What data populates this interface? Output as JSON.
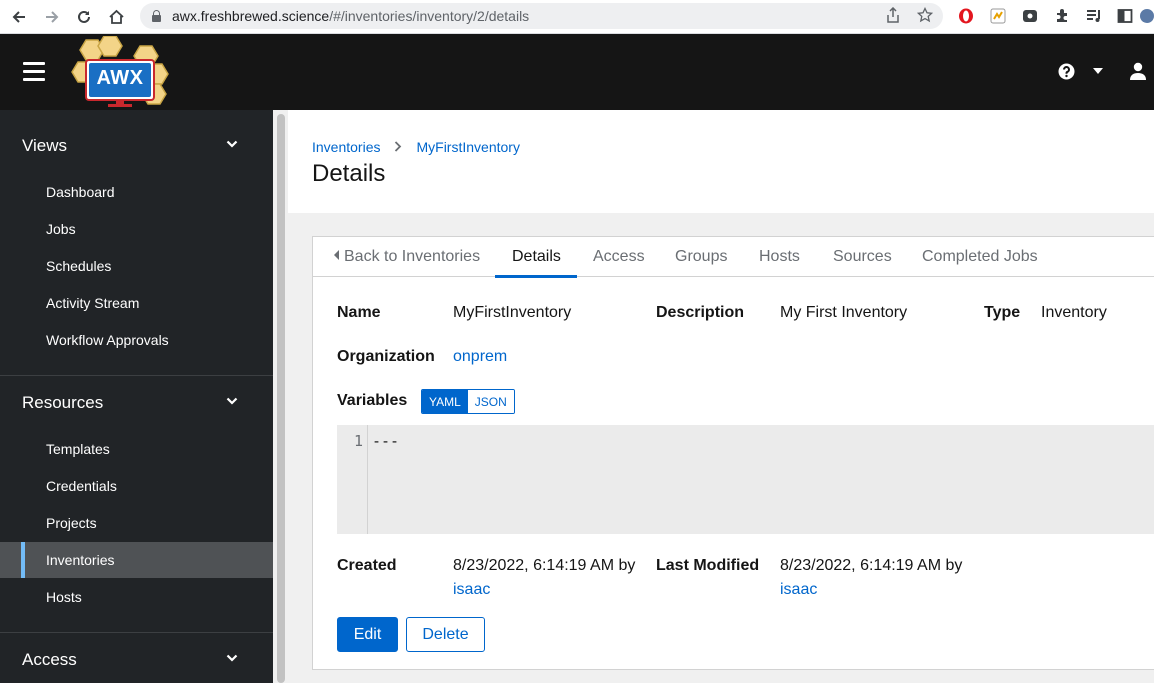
{
  "browser": {
    "url_host": "awx.freshbrewed.science",
    "url_path": "/#/inventories/inventory/2/details"
  },
  "app": {
    "logo_text": "AWX"
  },
  "sidebar": {
    "groups": [
      {
        "label": "Views",
        "items": [
          "Dashboard",
          "Jobs",
          "Schedules",
          "Activity Stream",
          "Workflow Approvals"
        ]
      },
      {
        "label": "Resources",
        "items": [
          "Templates",
          "Credentials",
          "Projects",
          "Inventories",
          "Hosts"
        ]
      },
      {
        "label": "Access",
        "items": []
      }
    ],
    "active_item": "Inventories"
  },
  "breadcrumb": {
    "parent": "Inventories",
    "current": "MyFirstInventory"
  },
  "page_title": "Details",
  "tabs": {
    "back": "Back to Inventories",
    "items": [
      "Details",
      "Access",
      "Groups",
      "Hosts",
      "Sources",
      "Completed Jobs"
    ],
    "active": "Details"
  },
  "details": {
    "name_label": "Name",
    "name_value": "MyFirstInventory",
    "description_label": "Description",
    "description_value": "My First Inventory",
    "type_label": "Type",
    "type_value": "Inventory",
    "organization_label": "Organization",
    "organization_value": "onprem",
    "variables_label": "Variables",
    "variables_yaml": "YAML",
    "variables_json": "JSON",
    "variables_line_number": "1",
    "variables_code": "---",
    "created_label": "Created",
    "created_value": "8/23/2022, 6:14:19 AM by",
    "created_by": "isaac",
    "modified_label": "Last Modified",
    "modified_value": "8/23/2022, 6:14:19 AM by",
    "modified_by": "isaac"
  },
  "actions": {
    "edit": "Edit",
    "delete": "Delete"
  },
  "colors": {
    "masthead": "#151515",
    "sidebar": "#212427",
    "sidebar_active": "#4f5255",
    "accent": "#0066cc",
    "active_indicator": "#73bcf7"
  }
}
